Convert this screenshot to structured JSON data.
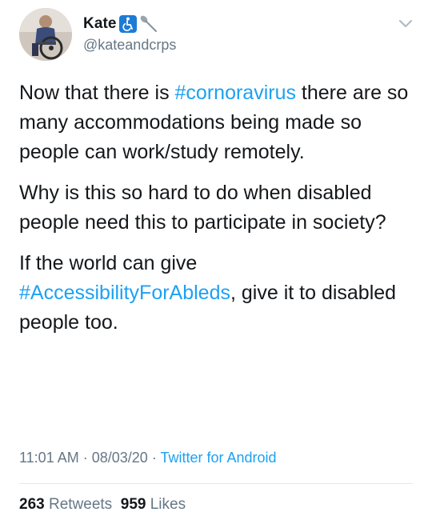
{
  "author": {
    "display_name": "Kate",
    "handle": "@kateandcrps",
    "badges": [
      "accessibility-icon",
      "spoon-icon"
    ]
  },
  "tweet": {
    "para1": {
      "pre": "Now that there is ",
      "hashtag": "#cornoravirus",
      "post": " there are so many accommodations being made so people can work/study remotely."
    },
    "para2": "Why is this so hard to do when disabled people need this to participate in society?",
    "para3": {
      "pre": "If the world can give ",
      "hashtag": "#AccessibilityForAbleds",
      "post": ", give it to disabled people too."
    }
  },
  "meta": {
    "time": "11:01 AM",
    "sep1": " · ",
    "date": "08/03/20",
    "sep2": " · ",
    "source": "Twitter for Android"
  },
  "stats": {
    "retweets_count": "263",
    "retweets_label": "Retweets",
    "likes_count": "959",
    "likes_label": "Likes"
  },
  "colors": {
    "link": "#1da1f2",
    "text": "#14171a",
    "muted": "#657786"
  }
}
